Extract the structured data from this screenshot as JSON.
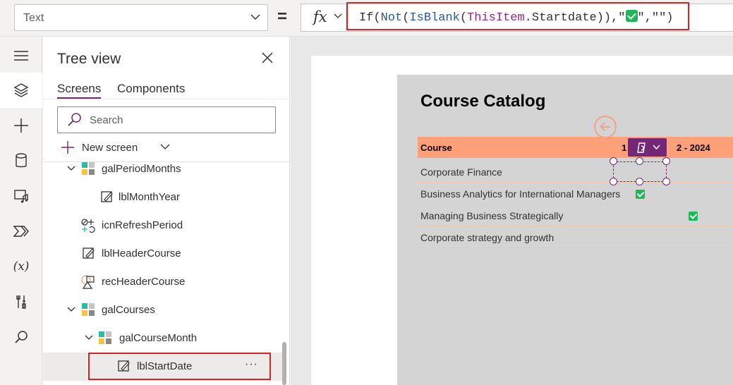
{
  "formula_bar": {
    "property": "Text",
    "fx_label": "fx",
    "formula": {
      "p1": "If(",
      "p2": "Not",
      "p3": "(",
      "p4": "IsBlank",
      "p5": "(",
      "p6": "ThisItem",
      "p7": ".Startdate)),\"",
      "p8": "\",\"\")"
    }
  },
  "rail": {
    "items": [
      "menu-icon",
      "layers-icon",
      "insert-icon",
      "data-icon",
      "media-icon",
      "power-automate-icon",
      "variables-icon",
      "tools-icon",
      "search-icon"
    ]
  },
  "tree_view": {
    "title": "Tree view",
    "tabs": [
      "Screens",
      "Components"
    ],
    "active_tab": "Screens",
    "search_placeholder": "Search",
    "new_screen_label": "New screen",
    "rows": [
      {
        "label": "galPeriodMonths",
        "icon": "gallery-icon",
        "expanded": true
      },
      {
        "label": "lblMonthYear",
        "icon": "label-icon"
      },
      {
        "label": "icnRefreshPeriod",
        "icon": "icon-control-icon"
      },
      {
        "label": "lblHeaderCourse",
        "icon": "label-icon"
      },
      {
        "label": "recHeaderCourse",
        "icon": "shape-icon"
      },
      {
        "label": "galCourses",
        "icon": "gallery-icon",
        "expanded": true
      },
      {
        "label": "galCourseMonth",
        "icon": "gallery-icon",
        "expanded": true
      },
      {
        "label": "lblStartDate",
        "icon": "label-icon",
        "selected": true
      }
    ],
    "more_label": "···"
  },
  "canvas": {
    "title": "Course Catalog",
    "header": {
      "course": "Course",
      "col1": "1",
      "col2": "2 - 2024"
    },
    "courses": [
      {
        "name": "Corporate Finance",
        "check_col": null
      },
      {
        "name": "Business Analytics for International Managers",
        "check_col": 1
      },
      {
        "name": "Managing Business Strategically",
        "check_col": 2
      },
      {
        "name": "Corporate strategy and growth",
        "check_col": null
      }
    ],
    "accent": "#742774",
    "header_color": "#ffa078",
    "check_color": "#1eb856"
  }
}
